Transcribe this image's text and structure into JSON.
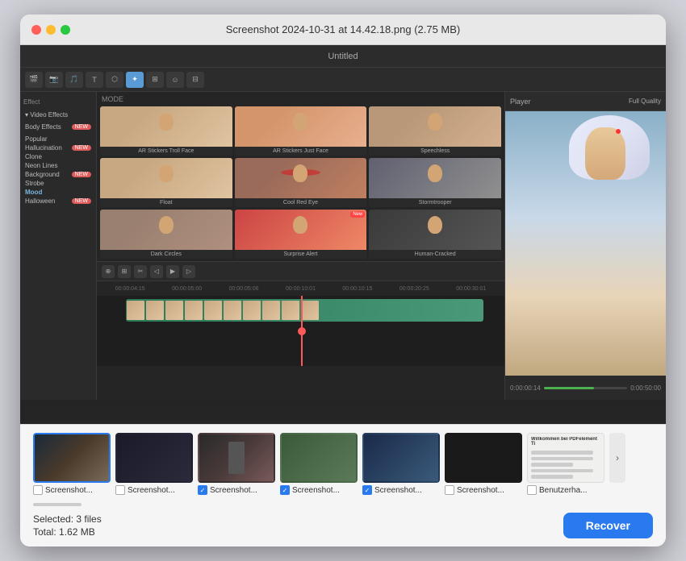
{
  "window": {
    "title": "Screenshot 2024-10-31 at 14.42.18.png (2.75 MB)"
  },
  "editor": {
    "title": "Untitled",
    "tabs": [
      "Media",
      "Stock Media",
      "Audio",
      "Titles",
      "Transitions",
      "Effects",
      "Filters",
      "Stickers",
      "Templates"
    ],
    "active_tab": "Effects",
    "sidebar": {
      "header": "Effect",
      "sections": [
        {
          "label": "Video Effects",
          "expanded": true
        },
        {
          "label": "Body Effects",
          "badge": true
        },
        {
          "label": "Popular"
        },
        {
          "label": "Hallucination",
          "badge": true
        },
        {
          "label": "Clone"
        },
        {
          "label": "Neon Lines"
        },
        {
          "label": "Background",
          "badge": true
        },
        {
          "label": "Strobe"
        },
        {
          "label": "Mood",
          "selected": true
        },
        {
          "label": "Halloween",
          "badge": true
        }
      ]
    },
    "effects": {
      "mode": "MODE",
      "items": [
        {
          "label": "AR Stickers Troll Face",
          "type": "face"
        },
        {
          "label": "AR Stickers Just Face",
          "type": "face_alt"
        },
        {
          "label": "Speechless",
          "type": "face"
        },
        {
          "label": "Float",
          "type": "face"
        },
        {
          "label": "Cool Red Eye",
          "type": "face_red"
        },
        {
          "label": "Stormtrooper",
          "type": "face_dark"
        },
        {
          "label": "Dark Circles",
          "type": "face"
        },
        {
          "label": "Surprise Alert",
          "type": "face_red",
          "badge": "New"
        },
        {
          "label": "Human-Cracked",
          "type": "silhouette"
        }
      ]
    },
    "preview": {
      "title": "Player",
      "quality": "Full Quality"
    },
    "timeline": {
      "markers": [
        "00:00:04:15",
        "00:00:05:00",
        "00:00:05:06",
        "00:00:10:01",
        "00:00:10:15",
        "00:00:20:25",
        "00:00:30:01"
      ]
    }
  },
  "thumbnails": [
    {
      "id": 1,
      "name": "Screenshot...",
      "checked": false,
      "selected": true,
      "style": "tb1"
    },
    {
      "id": 2,
      "name": "Screenshot...",
      "checked": false,
      "selected": false,
      "style": "tb2"
    },
    {
      "id": 3,
      "name": "Screenshot...",
      "checked": true,
      "selected": false,
      "style": "tb3"
    },
    {
      "id": 4,
      "name": "Screenshot...",
      "checked": true,
      "selected": false,
      "style": "tb4"
    },
    {
      "id": 5,
      "name": "Screenshot...",
      "checked": true,
      "selected": false,
      "style": "tb5"
    },
    {
      "id": 6,
      "name": "Screenshot...",
      "checked": false,
      "selected": false,
      "style": "tb6"
    },
    {
      "id": 7,
      "name": "Benutzerhа...",
      "checked": false,
      "selected": false,
      "style": "tb7"
    }
  ],
  "footer": {
    "selected_label": "Selected: 3 files",
    "total_label": "Total: 1.62 MB",
    "recover_button": "Recover"
  }
}
